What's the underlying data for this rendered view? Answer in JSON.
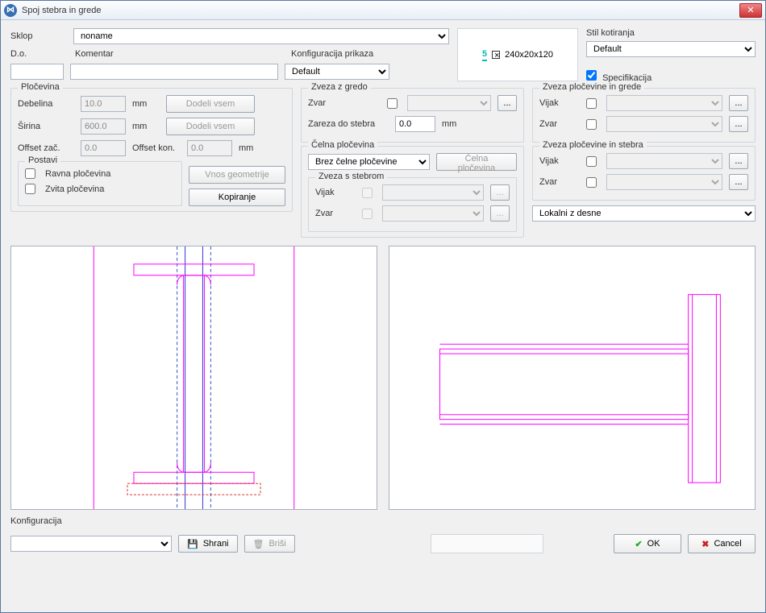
{
  "title": "Spoj stebra in grede",
  "labels": {
    "sklop": "Sklop",
    "do": "D.o.",
    "komentar": "Komentar",
    "konfigPrikaza": "Konfiguracija prikaza",
    "stilKotiranja": "Stil kotiranja",
    "specifikacija": "Specifikacija",
    "konfiguracija": "Konfiguracija"
  },
  "sklop": {
    "value": "noname"
  },
  "konfigPrikaza": {
    "value": "Default"
  },
  "stilKotiranja": {
    "value": "Default"
  },
  "preview": {
    "num": "5",
    "profile": "240x20x120"
  },
  "plocevina": {
    "title": "Pločevina",
    "debelina": "Debelina",
    "sirina": "Širina",
    "offsetZac": "Offset zač.",
    "offsetKon": "Offset kon.",
    "mm": "mm",
    "debelinaVal": "10.0",
    "sirinaVal": "600.0",
    "offsetZacVal": "0.0",
    "offsetKonVal": "0.0",
    "dodeliVsem": "Dodeli vsem"
  },
  "postavi": {
    "title": "Postavi",
    "ravna": "Ravna pločevina",
    "zvita": "Zvita pločevina",
    "vnosGeom": "Vnos geometrije",
    "kopiranje": "Kopiranje"
  },
  "zvezaGredo": {
    "title": "Zveza z gredo",
    "zvar": "Zvar",
    "zarezaDoStebra": "Zareza do stebra",
    "zarezaVal": "0.0",
    "mm": "mm"
  },
  "celnaPloc": {
    "title": "Čelna pločevina",
    "value": "Brez čelne pločevine",
    "btn": "Čelna pločevina"
  },
  "zvezaStebrom": {
    "title": "Zveza s stebrom",
    "vijak": "Vijak",
    "zvar": "Zvar"
  },
  "zvezaPlocGrede": {
    "title": "Zveza pločevine in grede",
    "vijak": "Vijak",
    "zvar": "Zvar"
  },
  "zvezaPlocStebra": {
    "title": "Zveza pločevine in stebra",
    "vijak": "Vijak",
    "zvar": "Zvar"
  },
  "lokalni": {
    "value": "Lokalni z desne"
  },
  "bottom": {
    "shrani": "Shrani",
    "brisi": "Briši",
    "ok": "OK",
    "cancel": "Cancel"
  }
}
